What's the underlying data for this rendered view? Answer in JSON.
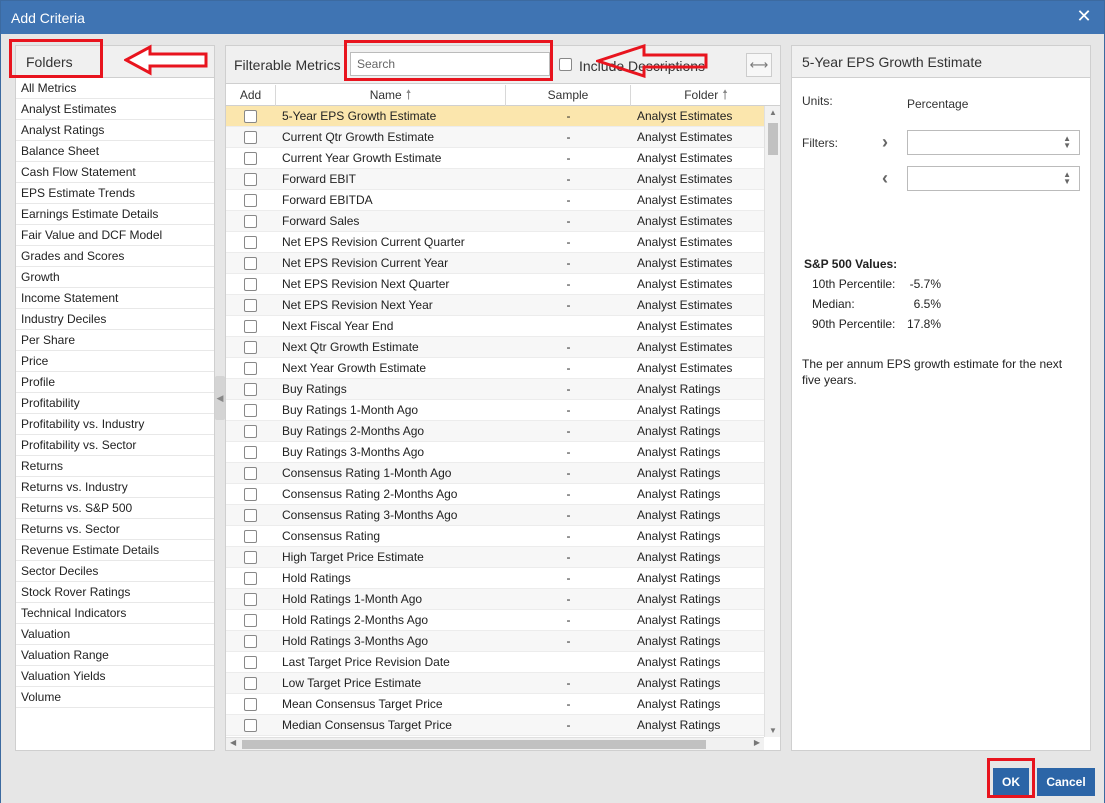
{
  "dialog": {
    "title": "Add Criteria",
    "close_icon": "close-icon"
  },
  "folders": {
    "header": "Folders",
    "items": [
      "All Metrics",
      "Analyst Estimates",
      "Analyst Ratings",
      "Balance Sheet",
      "Cash Flow Statement",
      "EPS Estimate Trends",
      "Earnings Estimate Details",
      "Fair Value and DCF Model",
      "Grades and Scores",
      "Growth",
      "Income Statement",
      "Industry Deciles",
      "Per Share",
      "Price",
      "Profile",
      "Profitability",
      "Profitability vs. Industry",
      "Profitability vs. Sector",
      "Returns",
      "Returns vs. Industry",
      "Returns vs. S&P 500",
      "Returns vs. Sector",
      "Revenue Estimate Details",
      "Sector Deciles",
      "Stock Rover Ratings",
      "Technical Indicators",
      "Valuation",
      "Valuation Range",
      "Valuation Yields",
      "Volume"
    ]
  },
  "metrics": {
    "title": "Filterable Metrics",
    "search_placeholder": "Search",
    "include_descriptions_label": "Include Descriptions",
    "columns": {
      "add": "Add",
      "name": "Name",
      "sample": "Sample",
      "folder": "Folder"
    },
    "rows": [
      {
        "name": "5-Year EPS Growth Estimate",
        "sample": "-",
        "folder": "Analyst Estimates",
        "selected": true
      },
      {
        "name": "Current Qtr Growth Estimate",
        "sample": "-",
        "folder": "Analyst Estimates"
      },
      {
        "name": "Current Year Growth Estimate",
        "sample": "-",
        "folder": "Analyst Estimates"
      },
      {
        "name": "Forward EBIT",
        "sample": "-",
        "folder": "Analyst Estimates"
      },
      {
        "name": "Forward EBITDA",
        "sample": "-",
        "folder": "Analyst Estimates"
      },
      {
        "name": "Forward Sales",
        "sample": "-",
        "folder": "Analyst Estimates"
      },
      {
        "name": "Net EPS Revision Current Quarter",
        "sample": "-",
        "folder": "Analyst Estimates"
      },
      {
        "name": "Net EPS Revision Current Year",
        "sample": "-",
        "folder": "Analyst Estimates"
      },
      {
        "name": "Net EPS Revision Next Quarter",
        "sample": "-",
        "folder": "Analyst Estimates"
      },
      {
        "name": "Net EPS Revision Next Year",
        "sample": "-",
        "folder": "Analyst Estimates"
      },
      {
        "name": "Next Fiscal Year End",
        "sample": "",
        "folder": "Analyst Estimates"
      },
      {
        "name": "Next Qtr Growth Estimate",
        "sample": "-",
        "folder": "Analyst Estimates"
      },
      {
        "name": "Next Year Growth Estimate",
        "sample": "-",
        "folder": "Analyst Estimates"
      },
      {
        "name": "Buy Ratings",
        "sample": "-",
        "folder": "Analyst Ratings"
      },
      {
        "name": "Buy Ratings 1-Month Ago",
        "sample": "-",
        "folder": "Analyst Ratings"
      },
      {
        "name": "Buy Ratings 2-Months Ago",
        "sample": "-",
        "folder": "Analyst Ratings"
      },
      {
        "name": "Buy Ratings 3-Months Ago",
        "sample": "-",
        "folder": "Analyst Ratings"
      },
      {
        "name": "Consensus Rating 1-Month Ago",
        "sample": "-",
        "folder": "Analyst Ratings"
      },
      {
        "name": "Consensus Rating 2-Months Ago",
        "sample": "-",
        "folder": "Analyst Ratings"
      },
      {
        "name": "Consensus Rating 3-Months Ago",
        "sample": "-",
        "folder": "Analyst Ratings"
      },
      {
        "name": "Consensus Rating",
        "sample": "-",
        "folder": "Analyst Ratings"
      },
      {
        "name": "High Target Price Estimate",
        "sample": "-",
        "folder": "Analyst Ratings"
      },
      {
        "name": "Hold Ratings",
        "sample": "-",
        "folder": "Analyst Ratings"
      },
      {
        "name": "Hold Ratings 1-Month Ago",
        "sample": "-",
        "folder": "Analyst Ratings"
      },
      {
        "name": "Hold Ratings 2-Months Ago",
        "sample": "-",
        "folder": "Analyst Ratings"
      },
      {
        "name": "Hold Ratings 3-Months Ago",
        "sample": "-",
        "folder": "Analyst Ratings"
      },
      {
        "name": "Last Target Price Revision Date",
        "sample": "",
        "folder": "Analyst Ratings"
      },
      {
        "name": "Low Target Price Estimate",
        "sample": "-",
        "folder": "Analyst Ratings"
      },
      {
        "name": "Mean Consensus Target Price",
        "sample": "-",
        "folder": "Analyst Ratings"
      },
      {
        "name": "Median Consensus Target Price",
        "sample": "-",
        "folder": "Analyst Ratings"
      }
    ]
  },
  "detail": {
    "title": "5-Year EPS Growth Estimate",
    "units_label": "Units:",
    "units_value": "Percentage",
    "filters_label": "Filters:",
    "sp500_title": "S&P 500 Values:",
    "sp500": [
      {
        "label": "10th Percentile:",
        "value": "-5.7%"
      },
      {
        "label": "Median:",
        "value": "6.5%"
      },
      {
        "label": "90th Percentile:",
        "value": "17.8%"
      }
    ],
    "description": "The per annum EPS growth estimate for the next five years."
  },
  "footer": {
    "ok_label": "OK",
    "cancel_label": "Cancel"
  },
  "colors": {
    "titlebar": "#3f74b3",
    "selected_row": "#fbe6ad",
    "annotation": "#e8141e",
    "button": "#2c65a7"
  }
}
